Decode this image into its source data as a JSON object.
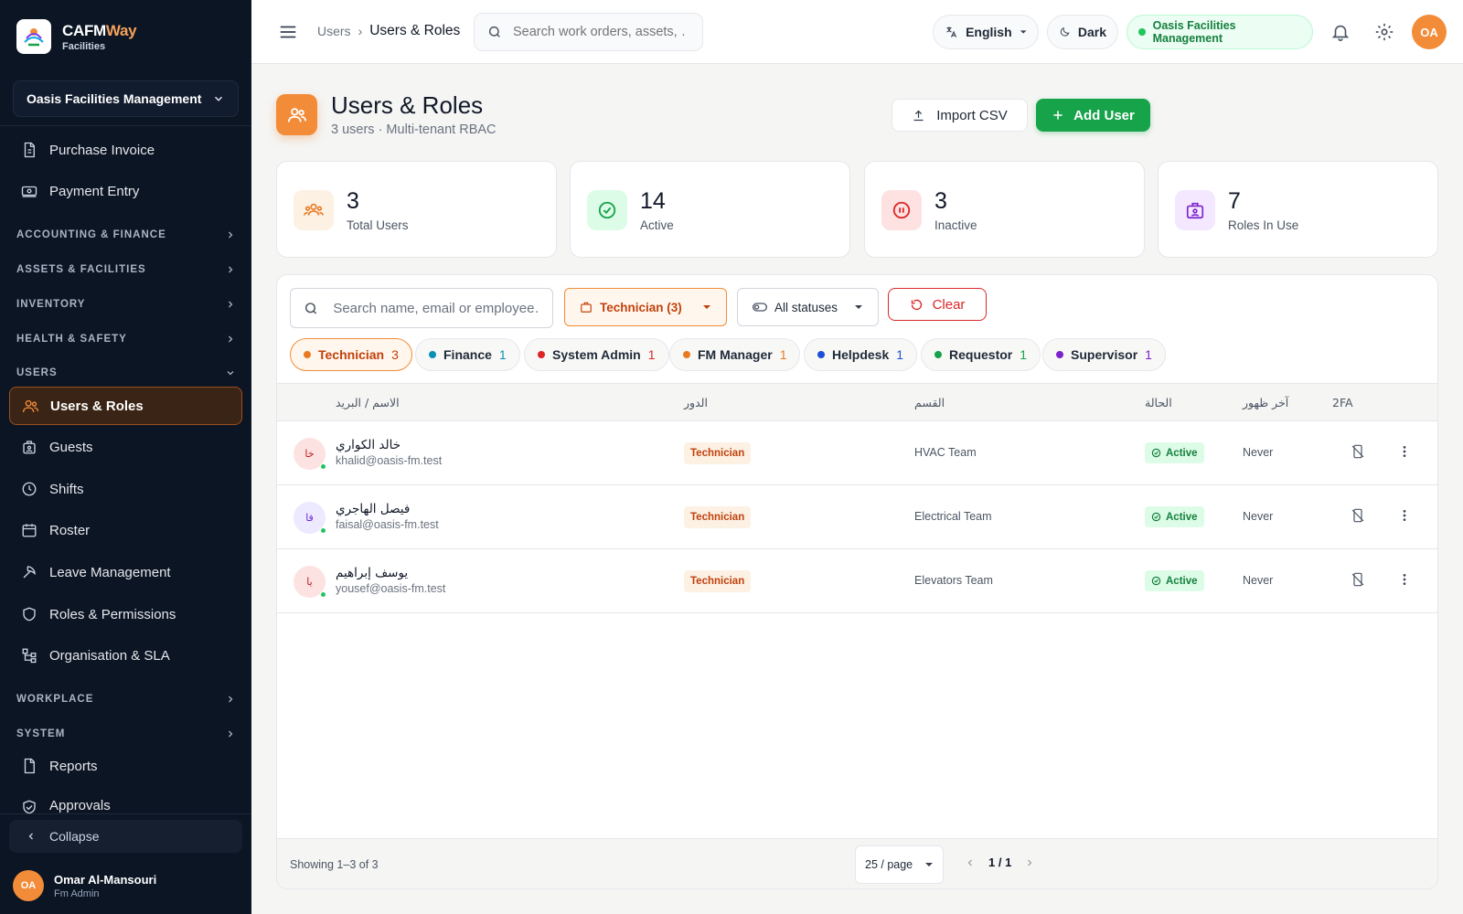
{
  "brand": {
    "name_main": "CAFM",
    "name_accent": "Way",
    "sub": "Facilities"
  },
  "sidebar": {
    "org_select": "Oasis Facilities Management",
    "items_top": [
      {
        "label": "Purchase Invoice",
        "icon": "invoice-icon"
      },
      {
        "label": "Payment Entry",
        "icon": "payment-icon"
      }
    ],
    "sections": [
      {
        "label": "ACCOUNTING & FINANCE",
        "expanded": false
      },
      {
        "label": "ASSETS & FACILITIES",
        "expanded": false
      },
      {
        "label": "INVENTORY",
        "expanded": false
      },
      {
        "label": "HEALTH & SAFETY",
        "expanded": false
      },
      {
        "label": "USERS",
        "expanded": true
      },
      {
        "label": "WORKPLACE",
        "expanded": false
      },
      {
        "label": "SYSTEM",
        "expanded": false
      }
    ],
    "users_items": [
      {
        "label": "Users & Roles",
        "icon": "users-icon",
        "active": true
      },
      {
        "label": "Guests",
        "icon": "guests-icon"
      },
      {
        "label": "Shifts",
        "icon": "clock-icon"
      },
      {
        "label": "Roster",
        "icon": "calendar-icon"
      },
      {
        "label": "Leave Management",
        "icon": "leave-icon"
      },
      {
        "label": "Roles & Permissions",
        "icon": "shield-icon"
      },
      {
        "label": "Organisation & SLA",
        "icon": "org-icon"
      }
    ],
    "items_bottom": [
      {
        "label": "Reports",
        "icon": "reports-icon"
      },
      {
        "label": "Approvals",
        "icon": "approvals-icon"
      }
    ],
    "collapse_label": "Collapse",
    "user": {
      "initials": "OA",
      "name": "Omar Al-Mansouri",
      "role": "Fm Admin"
    }
  },
  "topbar": {
    "breadcrumb": [
      "Users",
      "Users & Roles"
    ],
    "search_placeholder": "Search work orders, assets, …",
    "language": "English",
    "theme": "Dark",
    "org": "Oasis Facilities Management",
    "avatar": "OA"
  },
  "page": {
    "title": "Users & Roles",
    "subtitle": "3 users · Multi-tenant RBAC",
    "import_label": "Import CSV",
    "add_label": "Add User"
  },
  "stats": [
    {
      "value": "3",
      "label": "Total Users",
      "icon": "users-icon",
      "bg": "#fdf1e4",
      "color": "#ea7a22"
    },
    {
      "value": "14",
      "label": "Active",
      "icon": "check-circle-icon",
      "bg": "#dcfce7",
      "color": "#16a34a"
    },
    {
      "value": "3",
      "label": "Inactive",
      "icon": "pause-circle-icon",
      "bg": "#fee2e2",
      "color": "#dc2626"
    },
    {
      "value": "7",
      "label": "Roles In Use",
      "icon": "badge-icon",
      "bg": "#f3e8ff",
      "color": "#7e22ce"
    }
  ],
  "filters": {
    "search_placeholder": "Search name, email or employee…",
    "role_select": "Technician (3)",
    "status_select": "All statuses",
    "clear_label": "Clear"
  },
  "chips": [
    {
      "label": "Technician",
      "count": "3",
      "color": "#ea7a22",
      "selected": true
    },
    {
      "label": "Finance",
      "count": "1",
      "color": "#0891b2"
    },
    {
      "label": "System Admin",
      "count": "1",
      "color": "#dc2626"
    },
    {
      "label": "FM Manager",
      "count": "1",
      "color": "#ea7a22"
    },
    {
      "label": "Helpdesk",
      "count": "1",
      "color": "#1d4ed8"
    },
    {
      "label": "Requestor",
      "count": "1",
      "color": "#16a34a"
    },
    {
      "label": "Supervisor",
      "count": "1",
      "color": "#7e22ce"
    }
  ],
  "table": {
    "headers": {
      "name": "الاسم / البريد",
      "role": "الدور",
      "dept": "القسم",
      "status": "الحالة",
      "last_seen": "آخر ظهور",
      "twofa": "2FA"
    },
    "rows": [
      {
        "initials": "خا",
        "name": "خالد الكواري",
        "email": "khalid@oasis-fm.test",
        "role": "Technician",
        "dept": "HVAC Team",
        "status": "Active",
        "last_seen": "Never",
        "avatar_bg": "#fde2e2",
        "avatar_color": "#b91c1c"
      },
      {
        "initials": "فا",
        "name": "فيصل الهاجري",
        "email": "faisal@oasis-fm.test",
        "role": "Technician",
        "dept": "Electrical Team",
        "status": "Active",
        "last_seen": "Never",
        "avatar_bg": "#ede9fe",
        "avatar_color": "#6d28d9"
      },
      {
        "initials": "يا",
        "name": "يوسف إبراهيم",
        "email": "yousef@oasis-fm.test",
        "role": "Technician",
        "dept": "Elevators Team",
        "status": "Active",
        "last_seen": "Never",
        "avatar_bg": "#fde2e2",
        "avatar_color": "#b91c1c"
      }
    ]
  },
  "footer": {
    "showing": "Showing 1–3 of 3",
    "per_page": "25 / page",
    "page": "1 / 1"
  }
}
